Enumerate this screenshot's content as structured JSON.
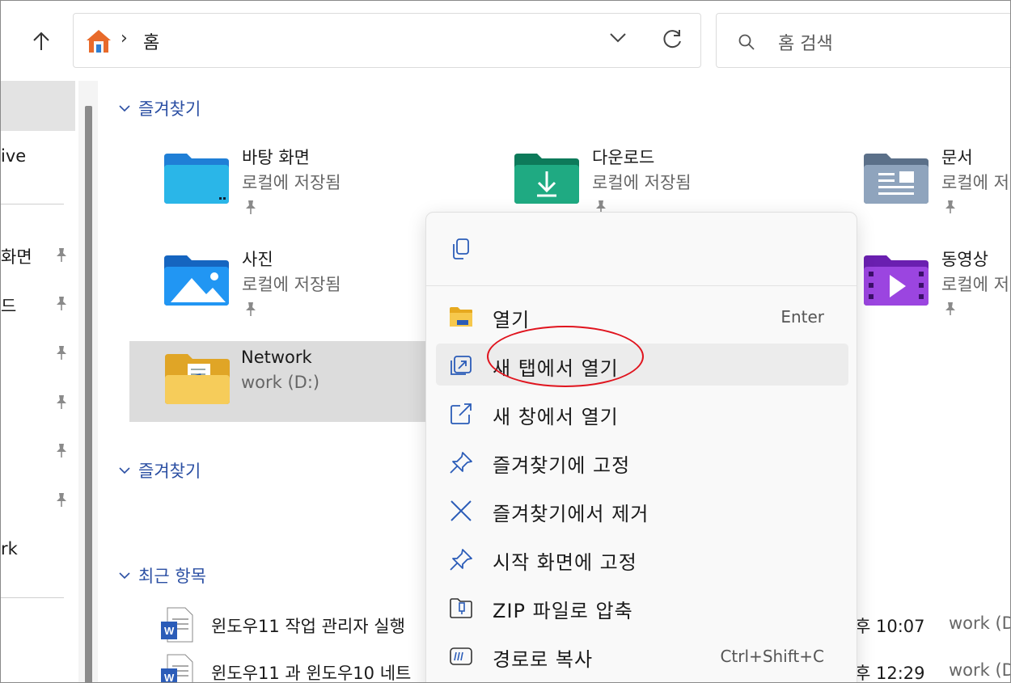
{
  "toolbar": {
    "address": {
      "separator": "›",
      "location": "홈"
    },
    "search": {
      "placeholder": "홈 검색"
    }
  },
  "sidebar": {
    "items": [
      {
        "label": "ive"
      },
      {
        "label": "바탕 화면"
      },
      {
        "label": "다운로드"
      },
      {
        "label": "rk"
      }
    ],
    "partial_labels": {
      "desktop": "화면",
      "download": "드",
      "onedrive": "ive",
      "network": "rk"
    }
  },
  "sections": {
    "favorites": {
      "title": "즐겨찾기",
      "items": [
        {
          "name": "바탕 화면",
          "sub": "로컬에 저장됨",
          "icon": "desktop-folder-icon"
        },
        {
          "name": "다운로드",
          "sub": "로컬에 저장됨",
          "icon": "download-folder-icon"
        },
        {
          "name": "문서",
          "sub": "로컬에 저",
          "icon": "documents-folder-icon"
        },
        {
          "name": "사진",
          "sub": "로컬에 저장됨",
          "icon": "pictures-folder-icon"
        },
        {
          "name": "동영상",
          "sub": "로컬에 저",
          "icon": "videos-folder-icon"
        },
        {
          "name": "Network",
          "sub": "work (D:)",
          "icon": "network-folder-icon"
        }
      ]
    },
    "favorites2": {
      "title": "즐겨찾기"
    },
    "recent": {
      "title": "최근 항목",
      "items": [
        {
          "name": "윈도우11 작업 관리자 실행",
          "time": "후 10:07",
          "location": "work (D"
        },
        {
          "name": "윈도우11 과 윈도우10 네트",
          "time": "후 12:29",
          "location": "work (D"
        }
      ]
    }
  },
  "context_menu": {
    "items": [
      {
        "label": "열기",
        "shortcut": "Enter",
        "icon": "open-folder-icon"
      },
      {
        "label": "새 탭에서 열기",
        "shortcut": "",
        "icon": "open-new-tab-icon"
      },
      {
        "label": "새 창에서 열기",
        "shortcut": "",
        "icon": "open-new-window-icon"
      },
      {
        "label": "즐겨찾기에 고정",
        "shortcut": "",
        "icon": "pin-icon"
      },
      {
        "label": "즐겨찾기에서 제거",
        "shortcut": "",
        "icon": "close-icon"
      },
      {
        "label": "시작 화면에 고정",
        "shortcut": "",
        "icon": "pin-icon"
      },
      {
        "label": "ZIP 파일로 압축",
        "shortcut": "",
        "icon": "zip-icon"
      },
      {
        "label": "경로로 복사",
        "shortcut": "Ctrl+Shift+C",
        "icon": "copy-path-icon"
      }
    ]
  },
  "colors": {
    "section_header": "#2b4fa3",
    "highlight_ellipse": "#e0141e",
    "selection": "#dcdcdc"
  }
}
